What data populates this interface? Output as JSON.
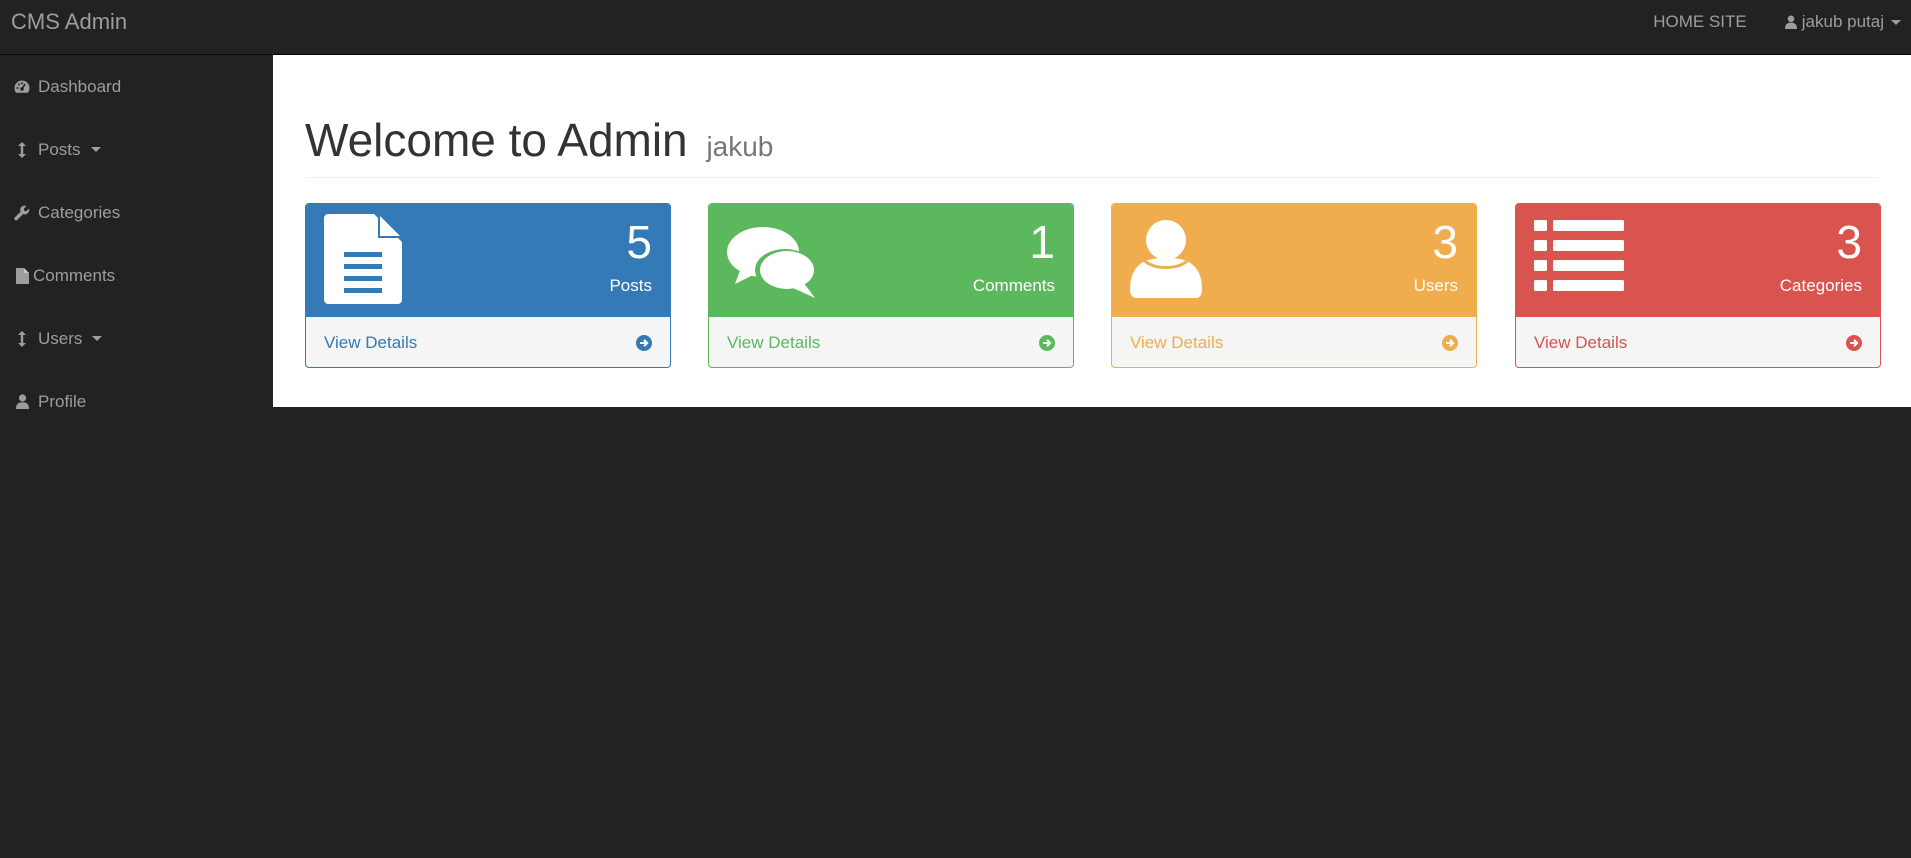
{
  "app": {
    "brand": "CMS Admin"
  },
  "topnav": {
    "home_site": "HOME SITE",
    "user_name": "jakub putaj"
  },
  "sidebar": {
    "items": [
      {
        "label": "Dashboard",
        "icon": "dashboard-icon"
      },
      {
        "label": "Posts",
        "icon": "arrows-v-icon",
        "dropdown": true
      },
      {
        "label": "Categories",
        "icon": "wrench-icon"
      },
      {
        "label": "Comments",
        "icon": "file-icon"
      },
      {
        "label": "Users",
        "icon": "arrows-v-icon",
        "dropdown": true
      },
      {
        "label": "Profile",
        "icon": "user-icon"
      }
    ]
  },
  "main": {
    "title": "Welcome to Admin",
    "subtitle": "jakub",
    "panels": [
      {
        "count": "5",
        "label": "Posts",
        "link": "View Details",
        "color": "#337ab7",
        "icon": "file-text-icon"
      },
      {
        "count": "1",
        "label": "Comments",
        "link": "View Details",
        "color": "#5cb85c",
        "icon": "comments-icon"
      },
      {
        "count": "3",
        "label": "Users",
        "link": "View Details",
        "color": "#f0ad4e",
        "icon": "user-icon"
      },
      {
        "count": "3",
        "label": "Categories",
        "link": "View Details",
        "color": "#d9534f",
        "icon": "list-icon"
      }
    ]
  }
}
